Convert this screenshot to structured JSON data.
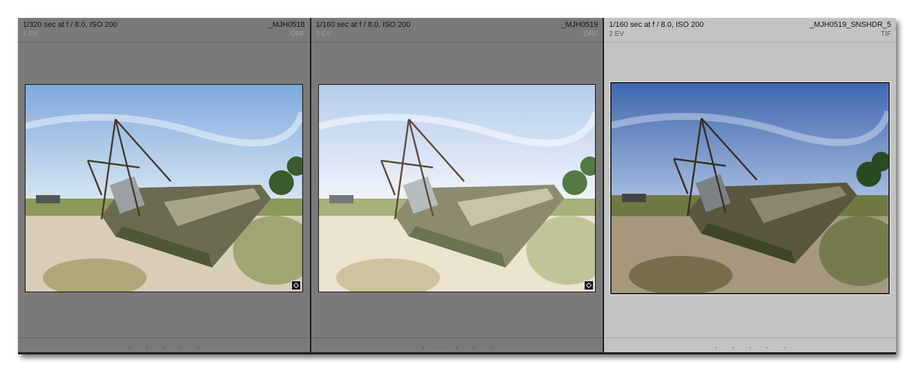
{
  "cells": [
    {
      "exposure": "1/320 sec at f / 8.0, ISO 200",
      "filename": "_MJH0518",
      "ev": "1 EV",
      "filetype": "ORF",
      "rating_dots": ". . . . .",
      "selected": false,
      "sky_top": "#7fa9de",
      "sky_bottom": "#d8e6f2"
    },
    {
      "exposure": "1/160 sec at f / 8.0, ISO 200",
      "filename": "_MJH0519",
      "ev": "2 EV",
      "filetype": "ORF",
      "rating_dots": ". . . . .",
      "selected": false,
      "sky_top": "#b4ccec",
      "sky_bottom": "#f1f5fa"
    },
    {
      "exposure": "1/160 sec at f / 8.0, ISO 200",
      "filename": "_MJH0519_SNSHDR_5",
      "ev": "2 EV",
      "filetype": "TIF",
      "rating_dots": ". . . . .",
      "selected": true,
      "sky_top": "#3f67b0",
      "sky_bottom": "#a9bfdf"
    }
  ]
}
